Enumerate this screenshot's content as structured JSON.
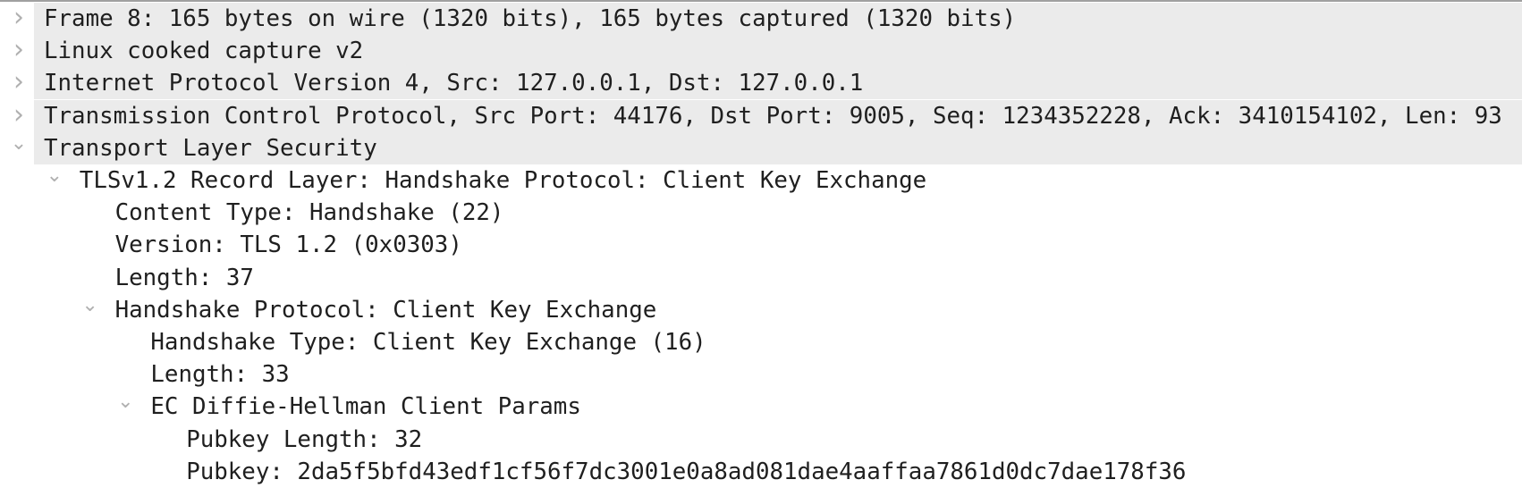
{
  "colors": {
    "selected_background": "#ebebeb",
    "text": "#1f1f1f",
    "chevron": "#b0b0b0"
  },
  "rows": [
    {
      "text": "Frame 8: 165 bytes on wire (1320 bits), 165 bytes captured (1320 bits)",
      "level": 0,
      "expander": "collapsed",
      "highlighted": true
    },
    {
      "text": "Linux cooked capture v2",
      "level": 0,
      "expander": "collapsed",
      "highlighted": true
    },
    {
      "text": "Internet Protocol Version 4, Src: 127.0.0.1, Dst: 127.0.0.1",
      "level": 0,
      "expander": "collapsed",
      "highlighted": true
    },
    {
      "text": "Transmission Control Protocol, Src Port: 44176, Dst Port: 9005, Seq: 1234352228, Ack: 3410154102, Len: 93",
      "level": 0,
      "expander": "collapsed",
      "highlighted": true
    },
    {
      "text": "Transport Layer Security",
      "level": 0,
      "expander": "expanded",
      "highlighted": true
    },
    {
      "text": "TLSv1.2 Record Layer: Handshake Protocol: Client Key Exchange",
      "level": 1,
      "expander": "expanded",
      "highlighted": false
    },
    {
      "text": "Content Type: Handshake (22)",
      "level": 2,
      "expander": "none",
      "highlighted": false
    },
    {
      "text": "Version: TLS 1.2 (0x0303)",
      "level": 2,
      "expander": "none",
      "highlighted": false
    },
    {
      "text": "Length: 37",
      "level": 2,
      "expander": "none",
      "highlighted": false
    },
    {
      "text": "Handshake Protocol: Client Key Exchange",
      "level": 2,
      "expander": "expanded",
      "highlighted": false
    },
    {
      "text": "Handshake Type: Client Key Exchange (16)",
      "level": 3,
      "expander": "none",
      "highlighted": false
    },
    {
      "text": "Length: 33",
      "level": 3,
      "expander": "none",
      "highlighted": false
    },
    {
      "text": "EC Diffie-Hellman Client Params",
      "level": 3,
      "expander": "expanded",
      "highlighted": false
    },
    {
      "text": "Pubkey Length: 32",
      "level": 4,
      "expander": "none",
      "highlighted": false
    },
    {
      "text": "Pubkey: 2da5f5bfd43edf1cf56f7dc3001e0a8ad081dae4aaffaa7861d0dc7dae178f36",
      "level": 4,
      "expander": "none",
      "highlighted": false
    }
  ]
}
